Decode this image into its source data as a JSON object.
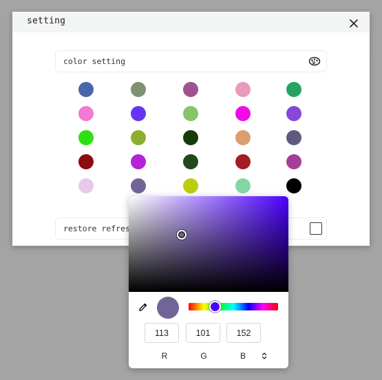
{
  "dialog": {
    "title": "setting",
    "close_icon": "close-icon",
    "color_setting_label": "color setting",
    "color_setting_icon": "palette-icon",
    "restore_refresh_label": "restore refresh"
  },
  "swatches": [
    [
      "#4866ae",
      "#7f9272",
      "#a0528f",
      "#e999b9",
      "#27a361"
    ],
    [
      "#f07ad4",
      "#6734f4",
      "#85c565",
      "#ee0ce8",
      "#8548d9"
    ],
    [
      "#2de011",
      "#8eaf2e",
      "#173b0b",
      "#dc9d70",
      "#615a80"
    ],
    [
      "#8c0c12",
      "#b423d5",
      "#224819",
      "#a41d26",
      "#a43e9b"
    ],
    [
      "#e8c9ea",
      "#716598",
      "#bdcc0d",
      "#84d7a5",
      "#000000"
    ]
  ],
  "color_picker": {
    "hue_color": "#4c00ff",
    "selected_color": "#716598",
    "r": "113",
    "g": "101",
    "b": "152",
    "r_label": "R",
    "g_label": "G",
    "b_label": "B",
    "eyedropper_icon": "eyedropper-icon",
    "mode_toggle_icon": "chevron-up-down-icon"
  }
}
